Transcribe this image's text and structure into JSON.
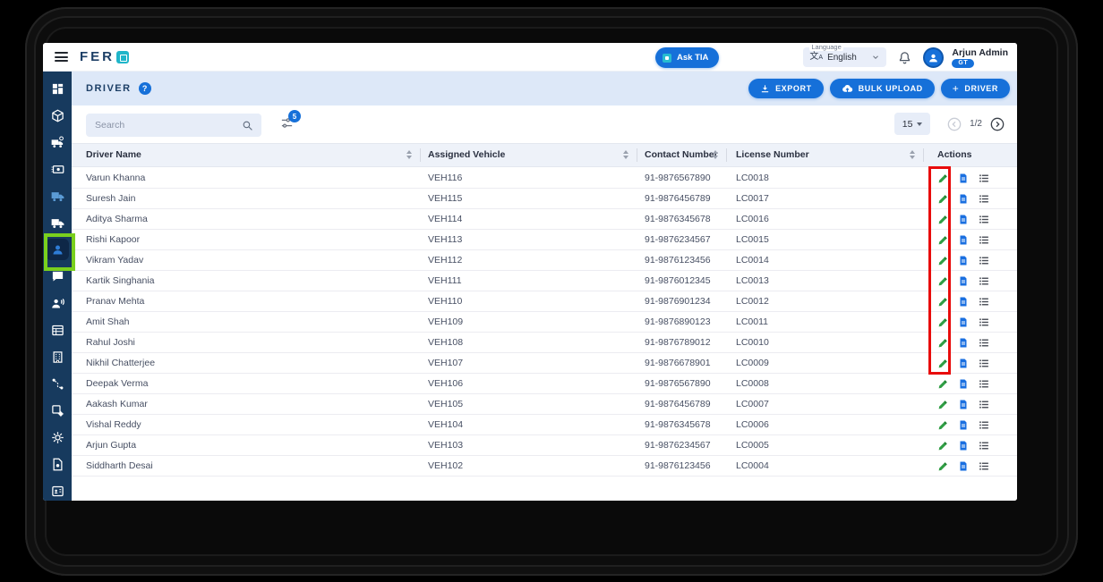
{
  "colors": {
    "accent_blue": "#1670D9",
    "sidebar_navy": "#173A5E",
    "logo_teal": "#1FB5C9",
    "header_band": "#DDE8F8",
    "edit_green": "#2F9E44",
    "doc_blue": "#1A6FE0",
    "annotation_red": "#E80C0C",
    "annotation_green": "#7AD01D"
  },
  "topbar": {
    "logo_text": "FER",
    "ask_tia_label": "Ask TIA",
    "language_label": "Language",
    "language_value": "English",
    "user_name": "Arjun Admin",
    "user_badge": "GT"
  },
  "page_header": {
    "title": "DRIVER",
    "help_glyph": "?",
    "export_label": "EXPORT",
    "bulk_upload_label": "BULK UPLOAD",
    "add_driver_plus": "+",
    "add_driver_label": "DRIVER"
  },
  "toolbar": {
    "search_placeholder": "Search",
    "filter_badge": "5",
    "page_size": "15",
    "page_indicator": "1/2"
  },
  "table": {
    "columns": [
      "Driver Name",
      "Assigned Vehicle",
      "Contact Number",
      "License Number",
      "Actions"
    ],
    "rows": [
      {
        "name": "Varun Khanna",
        "vehicle": "VEH116",
        "contact": "91-9876567890",
        "license": "LC0018"
      },
      {
        "name": "Suresh Jain",
        "vehicle": "VEH115",
        "contact": "91-9876456789",
        "license": "LC0017"
      },
      {
        "name": "Aditya Sharma",
        "vehicle": "VEH114",
        "contact": "91-9876345678",
        "license": "LC0016"
      },
      {
        "name": "Rishi Kapoor",
        "vehicle": "VEH113",
        "contact": "91-9876234567",
        "license": "LC0015"
      },
      {
        "name": "Vikram Yadav",
        "vehicle": "VEH112",
        "contact": "91-9876123456",
        "license": "LC0014"
      },
      {
        "name": "Kartik Singhania",
        "vehicle": "VEH111",
        "contact": "91-9876012345",
        "license": "LC0013"
      },
      {
        "name": "Pranav Mehta",
        "vehicle": "VEH110",
        "contact": "91-9876901234",
        "license": "LC0012"
      },
      {
        "name": "Amit Shah",
        "vehicle": "VEH109",
        "contact": "91-9876890123",
        "license": "LC0011"
      },
      {
        "name": "Rahul Joshi",
        "vehicle": "VEH108",
        "contact": "91-9876789012",
        "license": "LC0010"
      },
      {
        "name": "Nikhil Chatterjee",
        "vehicle": "VEH107",
        "contact": "91-9876678901",
        "license": "LC0009"
      },
      {
        "name": "Deepak Verma",
        "vehicle": "VEH106",
        "contact": "91-9876567890",
        "license": "LC0008"
      },
      {
        "name": "Aakash Kumar",
        "vehicle": "VEH105",
        "contact": "91-9876456789",
        "license": "LC0007"
      },
      {
        "name": "Vishal Reddy",
        "vehicle": "VEH104",
        "contact": "91-9876345678",
        "license": "LC0006"
      },
      {
        "name": "Arjun Gupta",
        "vehicle": "VEH103",
        "contact": "91-9876234567",
        "license": "LC0005"
      },
      {
        "name": "Siddharth Desai",
        "vehicle": "VEH102",
        "contact": "91-9876123456",
        "license": "LC0004"
      }
    ]
  },
  "sidebar": {
    "items": [
      "dashboard-icon",
      "package-icon",
      "truck-clock-icon",
      "payments-icon",
      "transport-truck-icon",
      "delivery-truck-icon",
      "drivers-icon",
      "chat-icon",
      "announce-contact-icon",
      "table-report-icon",
      "building-icon",
      "routes-icon",
      "inventory-gear-icon",
      "settings-gear-icon",
      "document-gear-icon",
      "id-card-icon"
    ],
    "active_item": "drivers-icon"
  },
  "annotations": {
    "red_box_target": "edit-action-icons-rows-1-10",
    "green_box_target": "sidebar-item-drivers"
  }
}
